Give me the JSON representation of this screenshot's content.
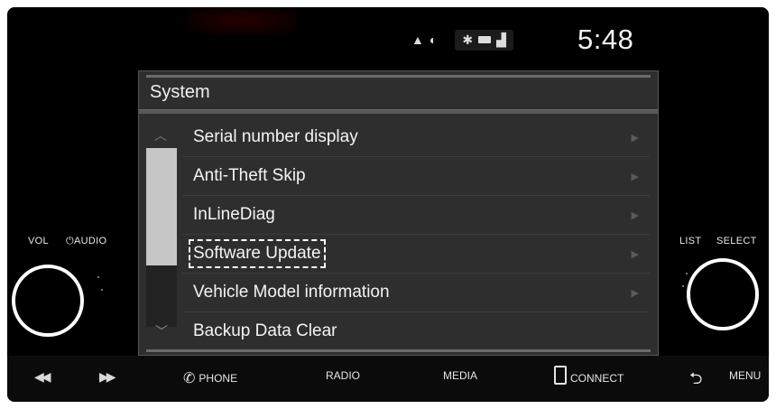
{
  "status": {
    "time": "5:48",
    "icons": [
      "navigation-arrow-icon",
      "media-play-icon",
      "bluetooth-icon",
      "battery-icon",
      "signal-icon"
    ]
  },
  "screen": {
    "title": "System",
    "items": [
      {
        "label": "Serial number display",
        "selected": false
      },
      {
        "label": "Anti-Theft Skip",
        "selected": false
      },
      {
        "label": "InLineDiag",
        "selected": false
      },
      {
        "label": "Software Update",
        "selected": true
      },
      {
        "label": "Vehicle Model information",
        "selected": false
      },
      {
        "label": "Backup Data Clear",
        "selected": false
      }
    ]
  },
  "left_panel": {
    "vol_label": "VOL",
    "audio_label": "AUDIO"
  },
  "right_panel": {
    "list_label": "LIST",
    "select_label": "SELECT"
  },
  "bottom_bar": {
    "phone": "PHONE",
    "radio": "RADIO",
    "media": "MEDIA",
    "connect": "CONNECT",
    "menu": "MENU"
  }
}
